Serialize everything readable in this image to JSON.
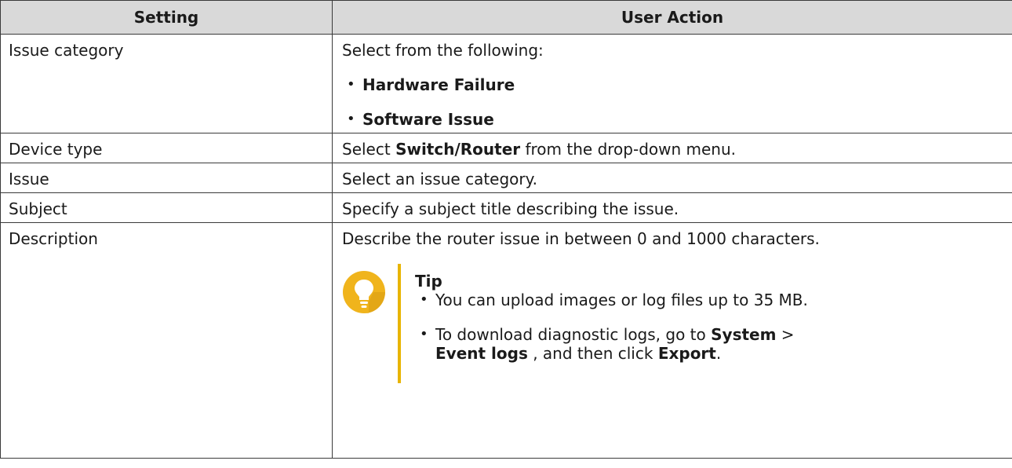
{
  "table": {
    "headers": [
      "Setting",
      "User Action"
    ],
    "rows": [
      {
        "setting": "Issue category",
        "action_intro": "Select from the following:",
        "options": [
          "Hardware Failure",
          "Software Issue"
        ]
      },
      {
        "setting": "Device type",
        "action_prefix": "Select ",
        "action_bold": "Switch/Router",
        "action_suffix": " from the drop-down menu."
      },
      {
        "setting": "Issue",
        "action": "Select an issue category."
      },
      {
        "setting": "Subject",
        "action": "Specify a subject title describing the issue."
      },
      {
        "setting": "Description",
        "action": "Describe the router issue in between 0 and 1000 characters.",
        "tip": {
          "title": "Tip",
          "item1": "You can upload images or log files up to 35 MB.",
          "item2_prefix": "To download diagnostic logs, go to ",
          "item2_bold1": "System",
          "item2_sep": " >",
          "item2_bold2": "Event logs",
          "item2_mid": " , and then click ",
          "item2_bold3": "Export",
          "item2_end": "."
        }
      }
    ]
  },
  "colors": {
    "header_bg": "#d9d9d9",
    "border": "#3a3a3a",
    "tip_accent": "#e8b400",
    "tip_icon_circle": "#f0b41c",
    "tip_icon_bulb": "#ffffff"
  },
  "icons": {
    "tip": "lightbulb-icon"
  }
}
